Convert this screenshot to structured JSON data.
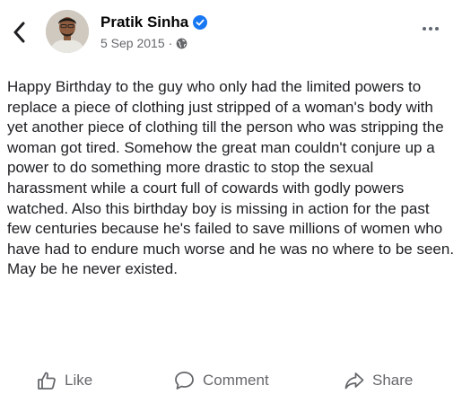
{
  "header": {
    "back_icon": "chevron-left-icon",
    "author_name": "Pratik Sinha",
    "verified_icon": "verified-badge-icon",
    "date": "5 Sep 2015",
    "separator": "·",
    "audience_icon": "globe-icon",
    "more_icon": "more-horizontal-icon"
  },
  "post": {
    "text": "Happy Birthday to the guy who only had the limited powers to replace a piece of clothing just stripped of a woman's body with yet another piece of clothing till the person who was stripping the woman got tired. Somehow the great man couldn't conjure up a power to do something more drastic to stop the sexual harassment while a court full of cowards with godly powers watched. Also this birthday boy is missing in action for the past few centuries because he's failed to save millions of women who have had to endure much worse and he was no where to be seen. May be he never existed."
  },
  "actions": {
    "like_label": "Like",
    "comment_label": "Comment",
    "share_label": "Share"
  },
  "colors": {
    "verified": "#1877f2",
    "secondary_text": "#65676b",
    "primary_text": "#1c1e21"
  }
}
